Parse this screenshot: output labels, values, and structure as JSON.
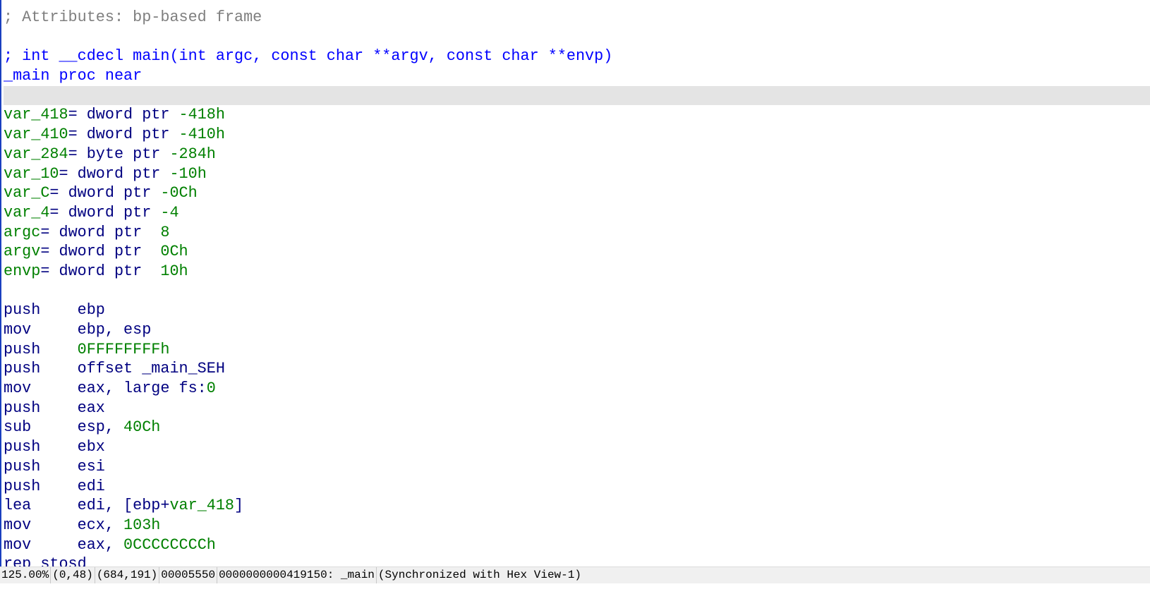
{
  "colors": {
    "comment": "#7f7f7f",
    "keyword_blue": "#0000ff",
    "instruction": "#000080",
    "number_green": "#008000",
    "highlight_line": "#e4e4e4"
  },
  "lines": [
    [
      {
        "t": "; Attributes: bp-based frame",
        "c": "cm"
      }
    ],
    [],
    [
      {
        "t": "; int __cdecl main(int argc, const char **argv, const char **envp)",
        "c": "bl"
      }
    ],
    [
      {
        "t": "_main proc near",
        "c": "bl"
      }
    ],
    {
      "highlight": true
    },
    [
      {
        "t": "var_418",
        "c": "gr"
      },
      {
        "t": "= dword ptr ",
        "c": "nv"
      },
      {
        "t": "-418h",
        "c": "gr"
      }
    ],
    [
      {
        "t": "var_410",
        "c": "gr"
      },
      {
        "t": "= dword ptr ",
        "c": "nv"
      },
      {
        "t": "-410h",
        "c": "gr"
      }
    ],
    [
      {
        "t": "var_284",
        "c": "gr"
      },
      {
        "t": "= byte ptr ",
        "c": "nv"
      },
      {
        "t": "-284h",
        "c": "gr"
      }
    ],
    [
      {
        "t": "var_10",
        "c": "gr"
      },
      {
        "t": "= dword ptr ",
        "c": "nv"
      },
      {
        "t": "-10h",
        "c": "gr"
      }
    ],
    [
      {
        "t": "var_C",
        "c": "gr"
      },
      {
        "t": "= dword ptr ",
        "c": "nv"
      },
      {
        "t": "-0Ch",
        "c": "gr"
      }
    ],
    [
      {
        "t": "var_4",
        "c": "gr"
      },
      {
        "t": "= dword ptr ",
        "c": "nv"
      },
      {
        "t": "-4",
        "c": "gr"
      }
    ],
    [
      {
        "t": "argc",
        "c": "gr"
      },
      {
        "t": "= dword ptr  ",
        "c": "nv"
      },
      {
        "t": "8",
        "c": "gr"
      }
    ],
    [
      {
        "t": "argv",
        "c": "gr"
      },
      {
        "t": "= dword ptr  ",
        "c": "nv"
      },
      {
        "t": "0Ch",
        "c": "gr"
      }
    ],
    [
      {
        "t": "envp",
        "c": "gr"
      },
      {
        "t": "= dword ptr  ",
        "c": "nv"
      },
      {
        "t": "10h",
        "c": "gr"
      }
    ],
    [],
    [
      {
        "t": "push    ebp",
        "c": "nv"
      }
    ],
    [
      {
        "t": "mov     ebp, esp",
        "c": "nv"
      }
    ],
    [
      {
        "t": "push    ",
        "c": "nv"
      },
      {
        "t": "0FFFFFFFFh",
        "c": "gr"
      }
    ],
    [
      {
        "t": "push    offset _main_SEH",
        "c": "nv"
      }
    ],
    [
      {
        "t": "mov     eax, large fs:",
        "c": "nv"
      },
      {
        "t": "0",
        "c": "gr"
      }
    ],
    [
      {
        "t": "push    eax",
        "c": "nv"
      }
    ],
    [
      {
        "t": "sub     esp, ",
        "c": "nv"
      },
      {
        "t": "40Ch",
        "c": "gr"
      }
    ],
    [
      {
        "t": "push    ebx",
        "c": "nv"
      }
    ],
    [
      {
        "t": "push    esi",
        "c": "nv"
      }
    ],
    [
      {
        "t": "push    edi",
        "c": "nv"
      }
    ],
    [
      {
        "t": "lea     edi, [ebp+",
        "c": "nv"
      },
      {
        "t": "var_418",
        "c": "gr"
      },
      {
        "t": "]",
        "c": "nv"
      }
    ],
    [
      {
        "t": "mov     ecx, ",
        "c": "nv"
      },
      {
        "t": "103h",
        "c": "gr"
      }
    ],
    [
      {
        "t": "mov     eax, ",
        "c": "nv"
      },
      {
        "t": "0CCCCCCCCh",
        "c": "gr"
      }
    ],
    [
      {
        "t": "rep stosd",
        "c": "nv"
      }
    ]
  ],
  "status": {
    "zoom": "125.00%",
    "graph_pos": "(0,48)",
    "mouse_pos": "(684,191)",
    "file_offset": "00005550",
    "address": "0000000000419150: _main",
    "sync": "(Synchronized with Hex View-1)"
  }
}
